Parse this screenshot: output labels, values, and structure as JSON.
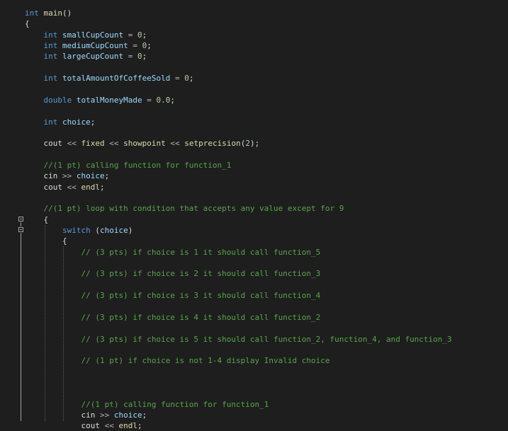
{
  "editor": {
    "lines": [
      {
        "id": "main-signature",
        "tokens": [
          {
            "t": "kw",
            "s": "int"
          },
          {
            "t": "pl",
            "s": " "
          },
          {
            "t": "fn",
            "s": "main"
          },
          {
            "t": "pl",
            "s": "()"
          }
        ]
      },
      {
        "id": "main-open-brace",
        "tokens": [
          {
            "t": "pl",
            "s": "{"
          }
        ]
      },
      {
        "id": "decl-small-cup",
        "tokens": [
          {
            "t": "pl",
            "s": "    "
          },
          {
            "t": "kw",
            "s": "int"
          },
          {
            "t": "pl",
            "s": " "
          },
          {
            "t": "id",
            "s": "smallCupCount"
          },
          {
            "t": "pl",
            "s": " "
          },
          {
            "t": "op",
            "s": "="
          },
          {
            "t": "pl",
            "s": " "
          },
          {
            "t": "num",
            "s": "0"
          },
          {
            "t": "pl",
            "s": ";"
          }
        ]
      },
      {
        "id": "decl-medium-cup",
        "tokens": [
          {
            "t": "pl",
            "s": "    "
          },
          {
            "t": "kw",
            "s": "int"
          },
          {
            "t": "pl",
            "s": " "
          },
          {
            "t": "id",
            "s": "mediumCupCount"
          },
          {
            "t": "pl",
            "s": " "
          },
          {
            "t": "op",
            "s": "="
          },
          {
            "t": "pl",
            "s": " "
          },
          {
            "t": "num",
            "s": "0"
          },
          {
            "t": "pl",
            "s": ";"
          }
        ]
      },
      {
        "id": "decl-large-cup",
        "tokens": [
          {
            "t": "pl",
            "s": "    "
          },
          {
            "t": "kw",
            "s": "int"
          },
          {
            "t": "pl",
            "s": " "
          },
          {
            "t": "id",
            "s": "largeCupCount"
          },
          {
            "t": "pl",
            "s": " "
          },
          {
            "t": "op",
            "s": "="
          },
          {
            "t": "pl",
            "s": " "
          },
          {
            "t": "num",
            "s": "0"
          },
          {
            "t": "pl",
            "s": ";"
          }
        ]
      },
      {
        "id": "blank-1",
        "tokens": []
      },
      {
        "id": "decl-total-coffee",
        "tokens": [
          {
            "t": "pl",
            "s": "    "
          },
          {
            "t": "kw",
            "s": "int"
          },
          {
            "t": "pl",
            "s": " "
          },
          {
            "t": "id",
            "s": "totalAmountOfCoffeeSold"
          },
          {
            "t": "pl",
            "s": " "
          },
          {
            "t": "op",
            "s": "="
          },
          {
            "t": "pl",
            "s": " "
          },
          {
            "t": "num",
            "s": "0"
          },
          {
            "t": "pl",
            "s": ";"
          }
        ]
      },
      {
        "id": "blank-2",
        "tokens": []
      },
      {
        "id": "decl-total-money",
        "tokens": [
          {
            "t": "pl",
            "s": "    "
          },
          {
            "t": "kw",
            "s": "double"
          },
          {
            "t": "pl",
            "s": " "
          },
          {
            "t": "id",
            "s": "totalMoneyMade"
          },
          {
            "t": "pl",
            "s": " "
          },
          {
            "t": "op",
            "s": "="
          },
          {
            "t": "pl",
            "s": " "
          },
          {
            "t": "num",
            "s": "0.0"
          },
          {
            "t": "pl",
            "s": ";"
          }
        ]
      },
      {
        "id": "blank-3",
        "tokens": []
      },
      {
        "id": "decl-choice",
        "tokens": [
          {
            "t": "pl",
            "s": "    "
          },
          {
            "t": "kw",
            "s": "int"
          },
          {
            "t": "pl",
            "s": " "
          },
          {
            "t": "id",
            "s": "choice"
          },
          {
            "t": "pl",
            "s": ";"
          }
        ]
      },
      {
        "id": "blank-4",
        "tokens": []
      },
      {
        "id": "cout-fixed",
        "tokens": [
          {
            "t": "pl",
            "s": "    "
          },
          {
            "t": "pl",
            "s": "cout"
          },
          {
            "t": "pl",
            "s": " "
          },
          {
            "t": "op",
            "s": "<<"
          },
          {
            "t": "pl",
            "s": " "
          },
          {
            "t": "fn",
            "s": "fixed"
          },
          {
            "t": "pl",
            "s": " "
          },
          {
            "t": "op",
            "s": "<<"
          },
          {
            "t": "pl",
            "s": " "
          },
          {
            "t": "fn",
            "s": "showpoint"
          },
          {
            "t": "pl",
            "s": " "
          },
          {
            "t": "op",
            "s": "<<"
          },
          {
            "t": "pl",
            "s": " "
          },
          {
            "t": "fn",
            "s": "setprecision"
          },
          {
            "t": "pl",
            "s": "("
          },
          {
            "t": "num",
            "s": "2"
          },
          {
            "t": "pl",
            "s": ");"
          }
        ]
      },
      {
        "id": "blank-5",
        "tokens": []
      },
      {
        "id": "comment-call-1",
        "tokens": [
          {
            "t": "pl",
            "s": "    "
          },
          {
            "t": "cm",
            "s": "//(1 pt) calling function for function_1"
          }
        ]
      },
      {
        "id": "cin-choice-1",
        "tokens": [
          {
            "t": "pl",
            "s": "    "
          },
          {
            "t": "pl",
            "s": "cin"
          },
          {
            "t": "pl",
            "s": " "
          },
          {
            "t": "op",
            "s": ">>"
          },
          {
            "t": "pl",
            "s": " "
          },
          {
            "t": "id",
            "s": "choice"
          },
          {
            "t": "pl",
            "s": ";"
          }
        ]
      },
      {
        "id": "cout-endl-1",
        "tokens": [
          {
            "t": "pl",
            "s": "    "
          },
          {
            "t": "pl",
            "s": "cout"
          },
          {
            "t": "pl",
            "s": " "
          },
          {
            "t": "op",
            "s": "<<"
          },
          {
            "t": "pl",
            "s": " "
          },
          {
            "t": "fn",
            "s": "endl"
          },
          {
            "t": "pl",
            "s": ";"
          }
        ]
      },
      {
        "id": "blank-6",
        "tokens": []
      },
      {
        "id": "comment-loop",
        "tokens": [
          {
            "t": "pl",
            "s": "    "
          },
          {
            "t": "cm",
            "s": "//(1 pt) loop with condition that accepts any value except for 9"
          }
        ]
      },
      {
        "id": "loop-open-brace",
        "tokens": [
          {
            "t": "pl",
            "s": "    {"
          }
        ]
      },
      {
        "id": "switch-stmt",
        "tokens": [
          {
            "t": "pl",
            "s": "        "
          },
          {
            "t": "kw",
            "s": "switch"
          },
          {
            "t": "pl",
            "s": " ("
          },
          {
            "t": "id",
            "s": "choice"
          },
          {
            "t": "pl",
            "s": ")"
          }
        ]
      },
      {
        "id": "switch-open-brace",
        "tokens": [
          {
            "t": "pl",
            "s": "        {"
          }
        ]
      },
      {
        "id": "comment-case-1",
        "tokens": [
          {
            "t": "pl",
            "s": "            "
          },
          {
            "t": "cm",
            "s": "// (3 pts) if choice is 1 it should call function_5"
          }
        ]
      },
      {
        "id": "blank-7",
        "tokens": []
      },
      {
        "id": "comment-case-2",
        "tokens": [
          {
            "t": "pl",
            "s": "            "
          },
          {
            "t": "cm",
            "s": "// (3 pts) if choice is 2 it should call function_3"
          }
        ]
      },
      {
        "id": "blank-8",
        "tokens": []
      },
      {
        "id": "comment-case-3",
        "tokens": [
          {
            "t": "pl",
            "s": "            "
          },
          {
            "t": "cm",
            "s": "// (3 pts) if choice is 3 it should call function_4"
          }
        ]
      },
      {
        "id": "blank-9",
        "tokens": []
      },
      {
        "id": "comment-case-4",
        "tokens": [
          {
            "t": "pl",
            "s": "            "
          },
          {
            "t": "cm",
            "s": "// (3 pts) if choice is 4 it should call function_2"
          }
        ]
      },
      {
        "id": "blank-10",
        "tokens": []
      },
      {
        "id": "comment-case-5",
        "tokens": [
          {
            "t": "pl",
            "s": "            "
          },
          {
            "t": "cm",
            "s": "// (3 pts) if choice is 5 it should call function_2, function_4, and function_3"
          }
        ]
      },
      {
        "id": "blank-11",
        "tokens": []
      },
      {
        "id": "comment-invalid",
        "tokens": [
          {
            "t": "pl",
            "s": "            "
          },
          {
            "t": "cm",
            "s": "// (1 pt) if choice is not 1-4 display Invalid choice"
          }
        ]
      },
      {
        "id": "blank-12",
        "tokens": []
      },
      {
        "id": "blank-13",
        "tokens": []
      },
      {
        "id": "blank-14",
        "tokens": []
      },
      {
        "id": "comment-call-2",
        "tokens": [
          {
            "t": "pl",
            "s": "            "
          },
          {
            "t": "cm",
            "s": "//(1 pt) calling function for function_1"
          }
        ]
      },
      {
        "id": "cin-choice-2",
        "tokens": [
          {
            "t": "pl",
            "s": "            "
          },
          {
            "t": "pl",
            "s": "cin"
          },
          {
            "t": "pl",
            "s": " "
          },
          {
            "t": "op",
            "s": ">>"
          },
          {
            "t": "pl",
            "s": " "
          },
          {
            "t": "id",
            "s": "choice"
          },
          {
            "t": "pl",
            "s": ";"
          }
        ]
      },
      {
        "id": "cout-endl-2",
        "tokens": [
          {
            "t": "pl",
            "s": "            "
          },
          {
            "t": "pl",
            "s": "cout"
          },
          {
            "t": "pl",
            "s": " "
          },
          {
            "t": "op",
            "s": "<<"
          },
          {
            "t": "pl",
            "s": " "
          },
          {
            "t": "fn",
            "s": "endl"
          },
          {
            "t": "pl",
            "s": ";"
          }
        ]
      }
    ]
  },
  "colors": {
    "background": "#1e1e1e",
    "keyword": "#569cd6",
    "function": "#dcdcaa",
    "identifier": "#9cdcfe",
    "number": "#b5cea8",
    "comment": "#57a64a",
    "plain": "#dcdcdc"
  }
}
